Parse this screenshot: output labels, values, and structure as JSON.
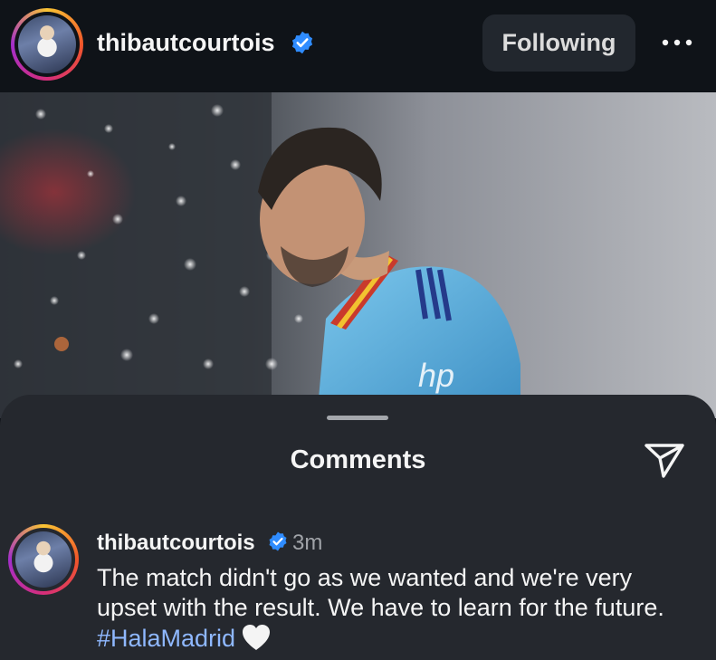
{
  "header": {
    "username": "thibautcourtois",
    "verified": true,
    "follow_label": "Following",
    "more_icon": "more-horizontal-icon"
  },
  "photo": {
    "logo_text": "hp"
  },
  "comments_sheet": {
    "title": "Comments",
    "share_icon": "send-icon",
    "comment": {
      "username": "thibautcourtois",
      "verified": true,
      "time": "3m",
      "text": "The match didn't go as we wanted and we're very upset with the result. We have to learn for the future.",
      "hashtag": "#HalaMadrid",
      "emoji_icon": "white-heart-icon"
    }
  },
  "colors": {
    "header_bg": "#0f1318",
    "sheet_bg": "#25282e",
    "verified_blue": "#2f8cff",
    "hashtag": "#8fb8ff",
    "button_bg": "#22272e"
  }
}
